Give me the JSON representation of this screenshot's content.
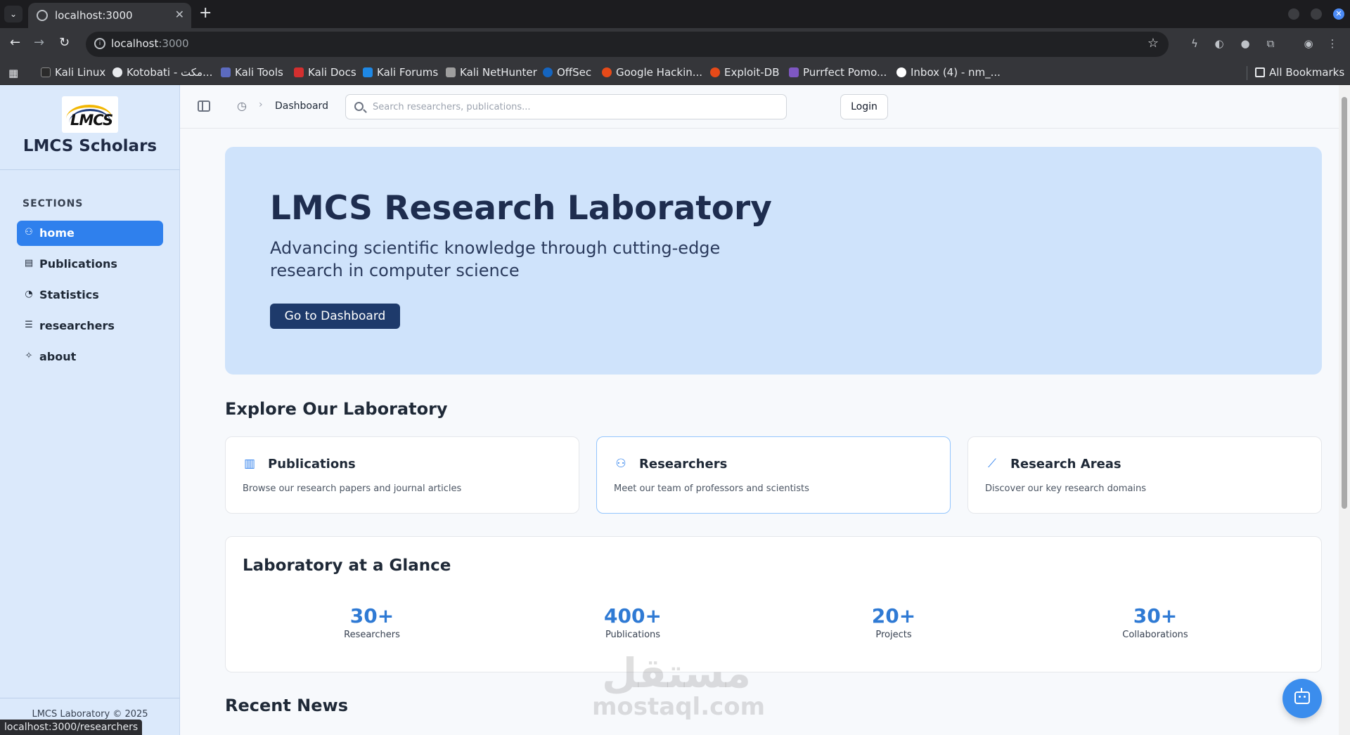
{
  "browser": {
    "tab_title": "localhost:3000",
    "url_host": "localhost",
    "url_port": ":3000",
    "bookmarks": [
      {
        "label": "Kali Linux",
        "color": "#2b2b2b"
      },
      {
        "label": "Kotobati - مكت...",
        "color": "#e8eaed"
      },
      {
        "label": "Kali Tools",
        "color": "#5c6bc0"
      },
      {
        "label": "Kali Docs",
        "color": "#d32f2f"
      },
      {
        "label": "Kali Forums",
        "color": "#1e88e5"
      },
      {
        "label": "Kali NetHunter",
        "color": "#9e9e9e"
      },
      {
        "label": "OffSec",
        "color": "#1565c0"
      },
      {
        "label": "Google Hackin...",
        "color": "#e64a19"
      },
      {
        "label": "Exploit-DB",
        "color": "#e64a19"
      },
      {
        "label": "Purrfect Pomo...",
        "color": "#7e57c2"
      },
      {
        "label": "Inbox (4) - nm_...",
        "color": "#ffffff"
      }
    ],
    "all_bookmarks": "All Bookmarks",
    "status_url": "localhost:3000/researchers"
  },
  "sidebar": {
    "brand": "LMCS Scholars",
    "logo_text": "LMCS",
    "sections_label": "SECTIONS",
    "items": [
      {
        "label": "home",
        "icon": "people-icon",
        "active": true
      },
      {
        "label": "Publications",
        "icon": "document-icon",
        "active": false
      },
      {
        "label": "Statistics",
        "icon": "clock-icon",
        "active": false
      },
      {
        "label": "researchers",
        "icon": "list-icon",
        "active": false
      },
      {
        "label": "about",
        "icon": "sparkle-icon",
        "active": false
      }
    ],
    "footer": "LMCS Laboratory © 2025"
  },
  "topbar": {
    "breadcrumb": "Dashboard",
    "search_placeholder": "Search researchers, publications...",
    "login_label": "Login"
  },
  "hero": {
    "title": "LMCS Research Laboratory",
    "subtitle": "Advancing scientific knowledge through cutting-edge research in computer science",
    "button_label": "Go to Dashboard"
  },
  "explore": {
    "title": "Explore Our Laboratory",
    "cards": [
      {
        "title": "Publications",
        "desc": "Browse our research papers and journal articles",
        "icon": "book-icon"
      },
      {
        "title": "Researchers",
        "desc": "Meet our team of professors and scientists",
        "icon": "users-icon"
      },
      {
        "title": "Research Areas",
        "desc": "Discover our key research domains",
        "icon": "chart-line-icon"
      }
    ]
  },
  "glance": {
    "title": "Laboratory at a Glance",
    "stats": [
      {
        "value": "30+",
        "label": "Researchers"
      },
      {
        "value": "400+",
        "label": "Publications"
      },
      {
        "value": "20+",
        "label": "Projects"
      },
      {
        "value": "30+",
        "label": "Collaborations"
      }
    ]
  },
  "news": {
    "title": "Recent News"
  },
  "watermark": {
    "arabic": "مستقل",
    "latin": "mostaql.com"
  },
  "colors": {
    "accent": "#2f80ed",
    "hero_bg": "#cfe3fb",
    "sidebar_bg": "#dbe9fb",
    "stat_value": "#2f7ad4",
    "hero_button": "#1e3a6b"
  }
}
